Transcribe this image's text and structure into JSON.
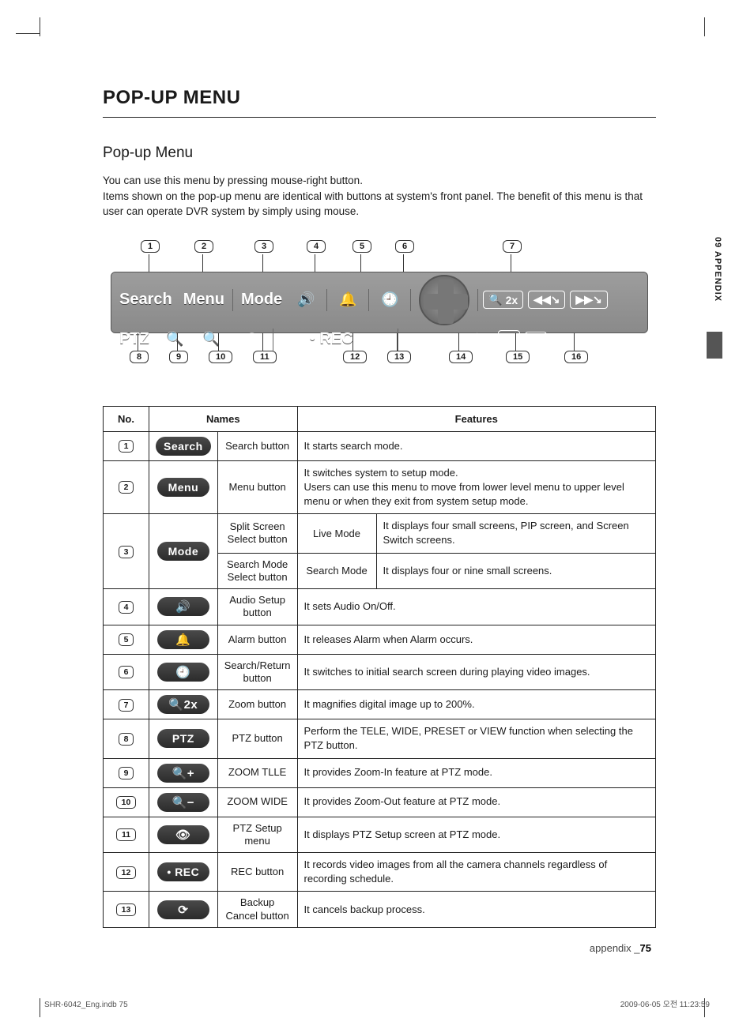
{
  "side_tab": "09 APPENDIX",
  "heading": "POP-UP MENU",
  "subheading": "Pop-up Menu",
  "intro_1": "You can use this menu by pressing mouse-right button.",
  "intro_2": "Items shown on the pop-up menu are identical with buttons at system's front panel. The benefit of this menu is that user can operate DVR system by simply using mouse.",
  "diagram": {
    "labels_top": [
      "1",
      "2",
      "3",
      "4",
      "5",
      "6",
      "7"
    ],
    "labels_bottom": [
      "8",
      "9",
      "10",
      "11",
      "12",
      "13",
      "14",
      "15",
      "16"
    ],
    "row1": {
      "search": "Search",
      "menu": "Menu",
      "mode": "Mode",
      "zoom2x": "2x"
    },
    "row2": {
      "ptz": "PTZ",
      "rec": "REC"
    }
  },
  "table": {
    "head": {
      "no": "No.",
      "names": "Names",
      "features": "Features"
    },
    "rows": [
      {
        "no": "1",
        "btn_text": "Search",
        "btn_type": "text",
        "name": "Search button",
        "feature": "It starts search mode."
      },
      {
        "no": "2",
        "btn_text": "Menu",
        "btn_type": "text",
        "name": "Menu button",
        "feature": "It switches system to setup mode.\nUsers can use this menu to move from lower level menu to upper level menu or when they exit from system setup mode."
      },
      {
        "no": "3",
        "btn_text": "Mode",
        "btn_type": "text",
        "sub": [
          {
            "name": "Split Screen Select button",
            "mode": "Live Mode",
            "feature": "It displays four small screens, PIP screen, and Screen Switch screens."
          },
          {
            "name": "Search Mode Select button",
            "mode": "Search Mode",
            "feature": "It displays four or nine small screens."
          }
        ]
      },
      {
        "no": "4",
        "btn_text": "🔊",
        "btn_type": "icon",
        "icon_name": "audio-icon",
        "name": "Audio Setup button",
        "feature": "It sets Audio On/Off."
      },
      {
        "no": "5",
        "btn_text": "🔔",
        "btn_type": "icon",
        "icon_name": "alarm-icon",
        "name": "Alarm button",
        "feature": "It releases Alarm when Alarm occurs."
      },
      {
        "no": "6",
        "btn_text": "🕘",
        "btn_type": "icon",
        "icon_name": "clock-icon",
        "name": "Search/Return button",
        "feature": "It switches to initial search screen during playing video images."
      },
      {
        "no": "7",
        "btn_text": "🔍2x",
        "btn_type": "icon",
        "icon_name": "zoom-2x-icon",
        "name": "Zoom button",
        "feature": "It magnifies digital image up to 200%."
      },
      {
        "no": "8",
        "btn_text": "PTZ",
        "btn_type": "text",
        "name": "PTZ button",
        "feature": "Perform the TELE, WIDE, PRESET or VIEW function when selecting the PTZ button."
      },
      {
        "no": "9",
        "btn_text": "🔍+",
        "btn_type": "icon",
        "icon_name": "zoom-in-icon",
        "name": "ZOOM TLLE",
        "feature": "It provides Zoom-In feature at PTZ mode."
      },
      {
        "no": "10",
        "btn_text": "🔍−",
        "btn_type": "icon",
        "icon_name": "zoom-out-icon",
        "name": "ZOOM WIDE",
        "feature": "It provides Zoom-Out feature at PTZ mode."
      },
      {
        "no": "11",
        "btn_text": "👁",
        "btn_type": "icon",
        "icon_name": "eye-icon",
        "name": "PTZ Setup menu",
        "feature": "It displays PTZ Setup screen at PTZ mode."
      },
      {
        "no": "12",
        "btn_text": "• REC",
        "btn_type": "text",
        "name": "REC button",
        "feature": "It records video images from all the camera channels regardless of recording schedule."
      },
      {
        "no": "13",
        "btn_text": "⟳",
        "btn_type": "icon",
        "icon_name": "cancel-icon",
        "name": "Backup Cancel button",
        "feature": "It cancels backup process."
      }
    ]
  },
  "footer": {
    "label": "appendix _",
    "page": "75"
  },
  "print_left": "SHR-6042_Eng.indb   75",
  "print_right": "2009-06-05   오전 11:23:59"
}
